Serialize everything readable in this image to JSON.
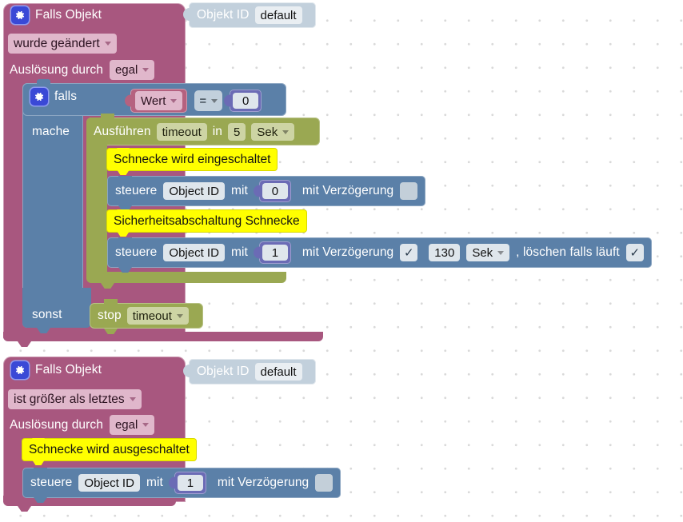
{
  "workspace": {
    "background": "#ffffff",
    "grid_dot_color": "#d9d9d9"
  },
  "colors": {
    "event_block": "#a8577f",
    "control_block": "#5b80a8",
    "timeout_block": "#9aa852",
    "object_id_block": "#c2d0dc",
    "number_block": "#6b6bb5",
    "value_block": "#b5617f",
    "comment_block": "#ffff00",
    "gear_icon": "#3a49d6"
  },
  "icons": {
    "gear": "gear-icon",
    "dropdown_caret": "chevron-down-icon",
    "checkbox_checked": "✓"
  },
  "blocks": {
    "event1": {
      "title": "Falls Objekt",
      "trigger_mode": "wurde geändert",
      "source_label": "Auslösung durch",
      "source_value": "egal",
      "objekt_id_label": "Objekt ID",
      "objekt_id_value": "default"
    },
    "if_block": {
      "if_label": "falls",
      "do_label": "mache",
      "else_label": "sonst",
      "condition": {
        "left": "Wert",
        "operator": "=",
        "right": "0"
      }
    },
    "timeout": {
      "run_label": "Ausführen",
      "name": "timeout",
      "in_label": "in",
      "delay": "5",
      "unit": "Sek"
    },
    "stop": {
      "label": "stop",
      "name": "timeout"
    },
    "comment1": {
      "text": "Schnecke wird eingeschaltet"
    },
    "comment2": {
      "text": "Sicherheitsabschaltung Schnecke"
    },
    "comment3": {
      "text": "Schnecke wird ausgeschaltet"
    },
    "control1": {
      "verb": "steuere",
      "object_id": "Object ID",
      "with_label": "mit",
      "value": "0",
      "delay_label": "mit Verzögerung",
      "delay_checked": false
    },
    "control2": {
      "verb": "steuere",
      "object_id": "Object ID",
      "with_label": "mit",
      "value": "1",
      "delay_label": "mit Verzögerung",
      "delay_checked": true,
      "delay_check_glyph": "✓",
      "delay_amount": "130",
      "delay_unit": "Sek",
      "clear_label": ", löschen falls läuft",
      "clear_checked": true,
      "clear_check_glyph": "✓"
    },
    "event2": {
      "title": "Falls Objekt",
      "trigger_mode": "ist größer als letztes",
      "source_label": "Auslösung durch",
      "source_value": "egal",
      "objekt_id_label": "Objekt ID",
      "objekt_id_value": "default"
    },
    "control3": {
      "verb": "steuere",
      "object_id": "Object ID",
      "with_label": "mit",
      "value": "1",
      "delay_label": "mit Verzögerung",
      "delay_checked": false
    }
  }
}
